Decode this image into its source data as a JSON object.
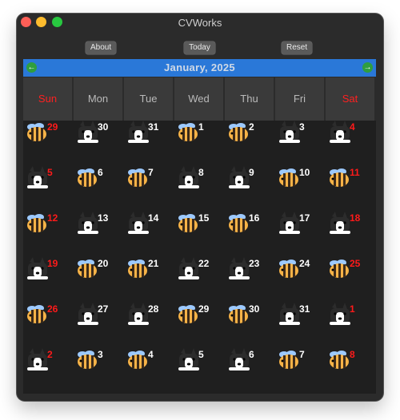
{
  "window": {
    "title": "CVWorks"
  },
  "toolbar": {
    "about": "About",
    "today": "Today",
    "reset": "Reset"
  },
  "month": {
    "title": "January,  2025"
  },
  "weekdays": [
    {
      "label": "Sun",
      "weekend": true
    },
    {
      "label": "Mon",
      "weekend": false
    },
    {
      "label": "Tue",
      "weekend": false
    },
    {
      "label": "Wed",
      "weekend": false
    },
    {
      "label": "Thu",
      "weekend": false
    },
    {
      "label": "Fri",
      "weekend": false
    },
    {
      "label": "Sat",
      "weekend": true
    }
  ],
  "days": [
    {
      "day": "29",
      "icon": "bee-icon",
      "red": true
    },
    {
      "day": "30",
      "icon": "dog-icon",
      "red": false
    },
    {
      "day": "31",
      "icon": "dog-icon",
      "red": false
    },
    {
      "day": "1",
      "icon": "bee-icon",
      "red": false
    },
    {
      "day": "2",
      "icon": "bee-icon",
      "red": false
    },
    {
      "day": "3",
      "icon": "dog-icon",
      "red": false
    },
    {
      "day": "4",
      "icon": "dog-icon",
      "red": true
    },
    {
      "day": "5",
      "icon": "dog-icon",
      "red": true
    },
    {
      "day": "6",
      "icon": "bee-icon",
      "red": false
    },
    {
      "day": "7",
      "icon": "bee-icon",
      "red": false
    },
    {
      "day": "8",
      "icon": "dog-icon",
      "red": false
    },
    {
      "day": "9",
      "icon": "dog-icon",
      "red": false
    },
    {
      "day": "10",
      "icon": "bee-icon",
      "red": false
    },
    {
      "day": "11",
      "icon": "bee-icon",
      "red": true
    },
    {
      "day": "12",
      "icon": "bee-icon",
      "red": true
    },
    {
      "day": "13",
      "icon": "dog-icon",
      "red": false
    },
    {
      "day": "14",
      "icon": "dog-icon",
      "red": false
    },
    {
      "day": "15",
      "icon": "bee-icon",
      "red": false
    },
    {
      "day": "16",
      "icon": "bee-icon",
      "red": false
    },
    {
      "day": "17",
      "icon": "dog-icon",
      "red": false
    },
    {
      "day": "18",
      "icon": "dog-icon",
      "red": true
    },
    {
      "day": "19",
      "icon": "dog-icon",
      "red": true
    },
    {
      "day": "20",
      "icon": "bee-icon",
      "red": false
    },
    {
      "day": "21",
      "icon": "bee-icon",
      "red": false
    },
    {
      "day": "22",
      "icon": "dog-icon",
      "red": false
    },
    {
      "day": "23",
      "icon": "dog-icon",
      "red": false
    },
    {
      "day": "24",
      "icon": "bee-icon",
      "red": false
    },
    {
      "day": "25",
      "icon": "bee-icon",
      "red": true
    },
    {
      "day": "26",
      "icon": "bee-icon",
      "red": true
    },
    {
      "day": "27",
      "icon": "dog-icon",
      "red": false
    },
    {
      "day": "28",
      "icon": "dog-icon",
      "red": false
    },
    {
      "day": "29",
      "icon": "bee-icon",
      "red": false
    },
    {
      "day": "30",
      "icon": "bee-icon",
      "red": false
    },
    {
      "day": "31",
      "icon": "dog-icon",
      "red": false
    },
    {
      "day": "1",
      "icon": "dog-icon",
      "red": true
    },
    {
      "day": "2",
      "icon": "dog-icon",
      "red": true
    },
    {
      "day": "3",
      "icon": "bee-icon",
      "red": false
    },
    {
      "day": "4",
      "icon": "bee-icon",
      "red": false
    },
    {
      "day": "5",
      "icon": "dog-icon",
      "red": false
    },
    {
      "day": "6",
      "icon": "dog-icon",
      "red": false
    },
    {
      "day": "7",
      "icon": "bee-icon",
      "red": false
    },
    {
      "day": "8",
      "icon": "bee-icon",
      "red": true
    }
  ],
  "colors": {
    "accent": "#2a78d8",
    "weekend": "#ff1a1a",
    "nav": "#2f9e3f"
  }
}
